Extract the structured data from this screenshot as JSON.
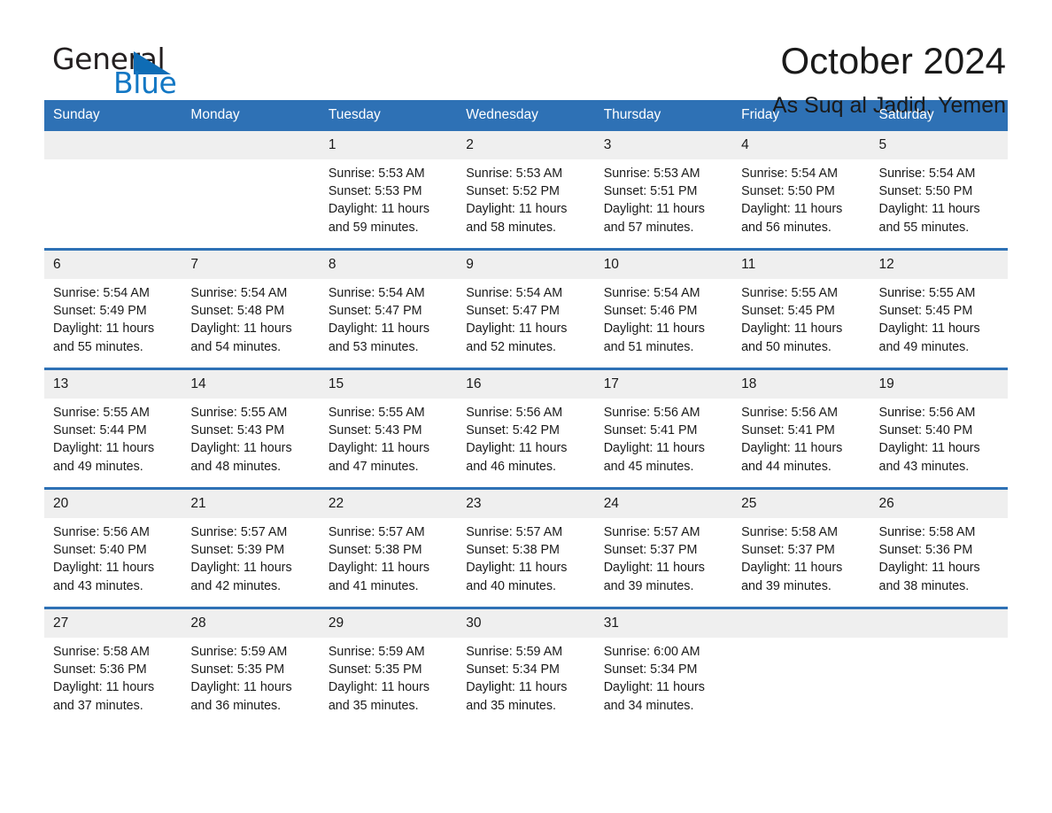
{
  "brand": {
    "word_one": "General",
    "word_two": "Blue",
    "accent_color": "#0e6cb5",
    "triangle_icon": "brand-triangle-icon"
  },
  "header": {
    "title": "October 2024",
    "subtitle": "As Suq al Jadid, Yemen"
  },
  "colors": {
    "header_blue": "#2e71b5",
    "daynum_gray": "#efefef",
    "text": "#1a1a1a",
    "header_text": "#ffffff"
  },
  "weekday_headers": [
    "Sunday",
    "Monday",
    "Tuesday",
    "Wednesday",
    "Thursday",
    "Friday",
    "Saturday"
  ],
  "weeks": [
    [
      {
        "day": "",
        "info": ""
      },
      {
        "day": "",
        "info": ""
      },
      {
        "day": "1",
        "info": "Sunrise: 5:53 AM\nSunset: 5:53 PM\nDaylight: 11 hours and 59 minutes."
      },
      {
        "day": "2",
        "info": "Sunrise: 5:53 AM\nSunset: 5:52 PM\nDaylight: 11 hours and 58 minutes."
      },
      {
        "day": "3",
        "info": "Sunrise: 5:53 AM\nSunset: 5:51 PM\nDaylight: 11 hours and 57 minutes."
      },
      {
        "day": "4",
        "info": "Sunrise: 5:54 AM\nSunset: 5:50 PM\nDaylight: 11 hours and 56 minutes."
      },
      {
        "day": "5",
        "info": "Sunrise: 5:54 AM\nSunset: 5:50 PM\nDaylight: 11 hours and 55 minutes."
      }
    ],
    [
      {
        "day": "6",
        "info": "Sunrise: 5:54 AM\nSunset: 5:49 PM\nDaylight: 11 hours and 55 minutes."
      },
      {
        "day": "7",
        "info": "Sunrise: 5:54 AM\nSunset: 5:48 PM\nDaylight: 11 hours and 54 minutes."
      },
      {
        "day": "8",
        "info": "Sunrise: 5:54 AM\nSunset: 5:47 PM\nDaylight: 11 hours and 53 minutes."
      },
      {
        "day": "9",
        "info": "Sunrise: 5:54 AM\nSunset: 5:47 PM\nDaylight: 11 hours and 52 minutes."
      },
      {
        "day": "10",
        "info": "Sunrise: 5:54 AM\nSunset: 5:46 PM\nDaylight: 11 hours and 51 minutes."
      },
      {
        "day": "11",
        "info": "Sunrise: 5:55 AM\nSunset: 5:45 PM\nDaylight: 11 hours and 50 minutes."
      },
      {
        "day": "12",
        "info": "Sunrise: 5:55 AM\nSunset: 5:45 PM\nDaylight: 11 hours and 49 minutes."
      }
    ],
    [
      {
        "day": "13",
        "info": "Sunrise: 5:55 AM\nSunset: 5:44 PM\nDaylight: 11 hours and 49 minutes."
      },
      {
        "day": "14",
        "info": "Sunrise: 5:55 AM\nSunset: 5:43 PM\nDaylight: 11 hours and 48 minutes."
      },
      {
        "day": "15",
        "info": "Sunrise: 5:55 AM\nSunset: 5:43 PM\nDaylight: 11 hours and 47 minutes."
      },
      {
        "day": "16",
        "info": "Sunrise: 5:56 AM\nSunset: 5:42 PM\nDaylight: 11 hours and 46 minutes."
      },
      {
        "day": "17",
        "info": "Sunrise: 5:56 AM\nSunset: 5:41 PM\nDaylight: 11 hours and 45 minutes."
      },
      {
        "day": "18",
        "info": "Sunrise: 5:56 AM\nSunset: 5:41 PM\nDaylight: 11 hours and 44 minutes."
      },
      {
        "day": "19",
        "info": "Sunrise: 5:56 AM\nSunset: 5:40 PM\nDaylight: 11 hours and 43 minutes."
      }
    ],
    [
      {
        "day": "20",
        "info": "Sunrise: 5:56 AM\nSunset: 5:40 PM\nDaylight: 11 hours and 43 minutes."
      },
      {
        "day": "21",
        "info": "Sunrise: 5:57 AM\nSunset: 5:39 PM\nDaylight: 11 hours and 42 minutes."
      },
      {
        "day": "22",
        "info": "Sunrise: 5:57 AM\nSunset: 5:38 PM\nDaylight: 11 hours and 41 minutes."
      },
      {
        "day": "23",
        "info": "Sunrise: 5:57 AM\nSunset: 5:38 PM\nDaylight: 11 hours and 40 minutes."
      },
      {
        "day": "24",
        "info": "Sunrise: 5:57 AM\nSunset: 5:37 PM\nDaylight: 11 hours and 39 minutes."
      },
      {
        "day": "25",
        "info": "Sunrise: 5:58 AM\nSunset: 5:37 PM\nDaylight: 11 hours and 39 minutes."
      },
      {
        "day": "26",
        "info": "Sunrise: 5:58 AM\nSunset: 5:36 PM\nDaylight: 11 hours and 38 minutes."
      }
    ],
    [
      {
        "day": "27",
        "info": "Sunrise: 5:58 AM\nSunset: 5:36 PM\nDaylight: 11 hours and 37 minutes."
      },
      {
        "day": "28",
        "info": "Sunrise: 5:59 AM\nSunset: 5:35 PM\nDaylight: 11 hours and 36 minutes."
      },
      {
        "day": "29",
        "info": "Sunrise: 5:59 AM\nSunset: 5:35 PM\nDaylight: 11 hours and 35 minutes."
      },
      {
        "day": "30",
        "info": "Sunrise: 5:59 AM\nSunset: 5:34 PM\nDaylight: 11 hours and 35 minutes."
      },
      {
        "day": "31",
        "info": "Sunrise: 6:00 AM\nSunset: 5:34 PM\nDaylight: 11 hours and 34 minutes."
      },
      {
        "day": "",
        "info": ""
      },
      {
        "day": "",
        "info": ""
      }
    ]
  ]
}
